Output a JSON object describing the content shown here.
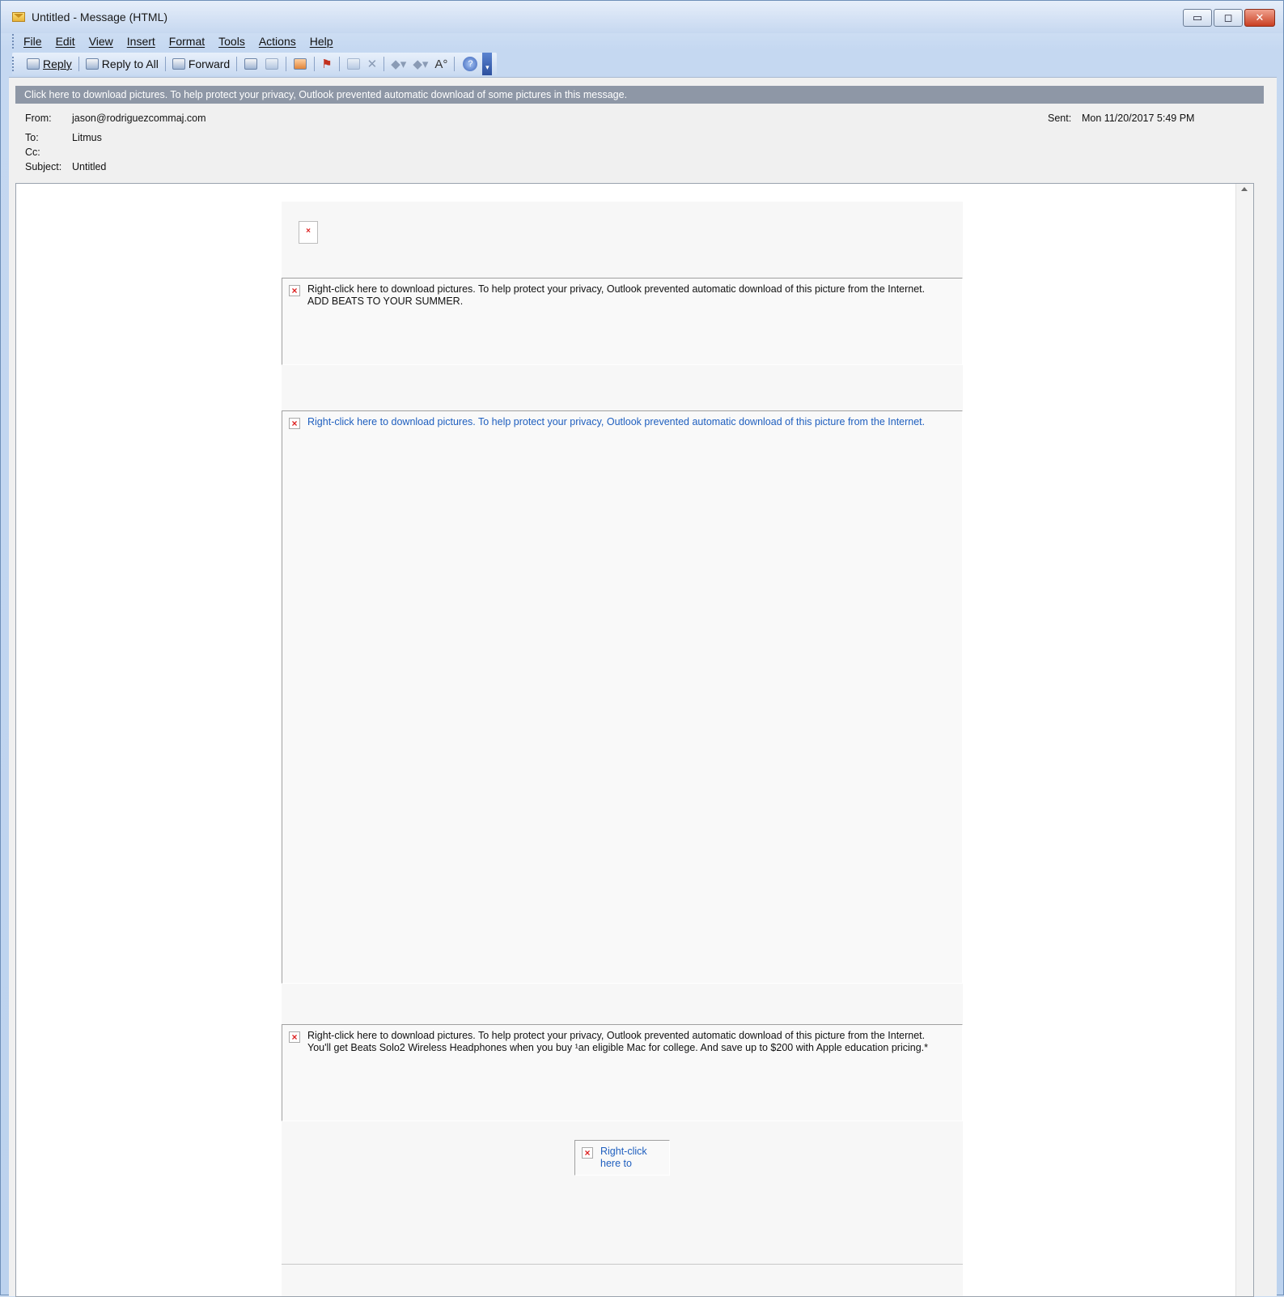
{
  "window": {
    "title": "Untitled - Message (HTML)",
    "controls": {
      "minimize": "▭",
      "maximize": "◻",
      "close": "✕"
    }
  },
  "menubar": {
    "items": [
      "File",
      "Edit",
      "View",
      "Insert",
      "Format",
      "Tools",
      "Actions",
      "Help"
    ]
  },
  "toolbar": {
    "reply": "Reply",
    "reply_all": "Reply to All",
    "forward": "Forward",
    "font_size_glyph": "A°",
    "help_glyph": "?"
  },
  "infobar": {
    "text": "Click here to download pictures. To help protect your privacy, Outlook prevented automatic download of some pictures in this message."
  },
  "header": {
    "from_label": "From:",
    "from_value": "jason@rodriguezcommaj.com",
    "to_label": "To:",
    "to_value": "Litmus",
    "cc_label": "Cc:",
    "cc_value": "",
    "subject_label": "Subject:",
    "subject_value": "Untitled",
    "sent_label": "Sent:",
    "sent_value": "Mon 11/20/2017 5:49 PM"
  },
  "body": {
    "placeholder_1_line1": "Right-click here to download pictures.  To help protect your privacy, Outlook prevented automatic download of this picture from the Internet.",
    "placeholder_1_line2": "ADD BEATS TO YOUR SUMMER.",
    "placeholder_2_line1": "Right-click here to download pictures.  To help protect your privacy, Outlook prevented automatic download of this picture from the Internet.",
    "placeholder_3_line1": "Right-click here to download pictures.  To help protect your privacy, Outlook prevented automatic download of this picture from the Internet.",
    "placeholder_3_line2": "You'll get Beats Solo2 Wireless Headphones when you buy ¹an eligible Mac for college. And save up to $200 with Apple education pricing.*",
    "placeholder_4_line1": "Right-click",
    "placeholder_4_line2": "here to",
    "broken_icon": "×"
  }
}
